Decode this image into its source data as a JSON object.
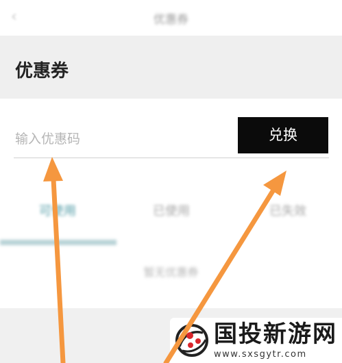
{
  "navbar": {
    "title": "优惠券"
  },
  "section": {
    "title": "优惠券"
  },
  "redeem": {
    "placeholder": "输入优惠码",
    "button_label": "兑换"
  },
  "tabs": [
    {
      "label": "可使用"
    },
    {
      "label": "已使用"
    },
    {
      "label": "已失效"
    }
  ],
  "empty_state": {
    "text": "暂无优惠券"
  },
  "watermark": {
    "title": "国投新游网",
    "url": "www.sxsgytr.com"
  },
  "colors": {
    "accent_tab": "#4f9aa5",
    "button_bg": "#0b0b0b",
    "arrow": "#f5973f"
  }
}
